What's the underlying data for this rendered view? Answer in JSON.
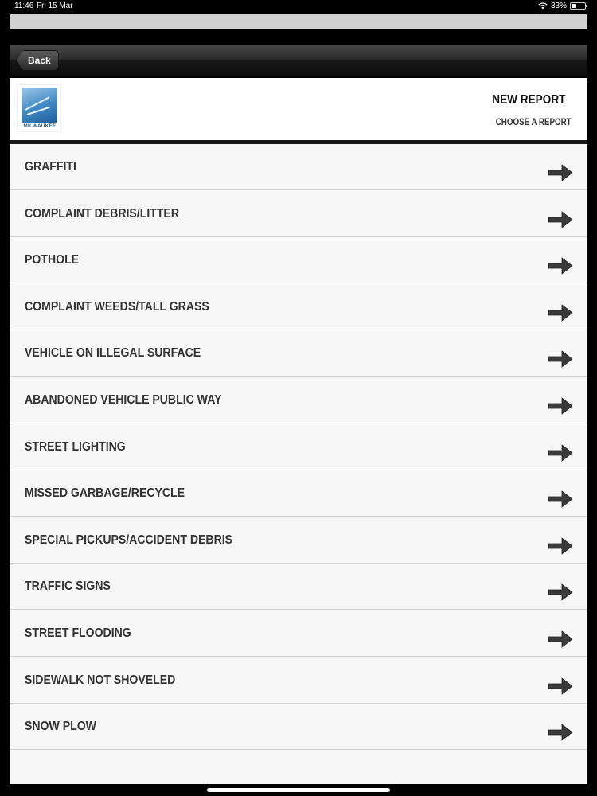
{
  "status": {
    "time": "11:46",
    "date": "Fri 15 Mar",
    "battery": "33%",
    "battery_level": 0.33
  },
  "nav": {
    "back_label": "Back"
  },
  "header": {
    "logo_text": "MILWAUKEE",
    "title": "NEW REPORT",
    "subtitle": "CHOOSE A REPORT"
  },
  "reports": [
    "GRAFFITI",
    "COMPLAINT DEBRIS/LITTER",
    "POTHOLE",
    "COMPLAINT WEEDS/TALL GRASS",
    "VEHICLE ON ILLEGAL SURFACE",
    "ABANDONED VEHICLE PUBLIC WAY",
    "STREET LIGHTING",
    "MISSED GARBAGE/RECYCLE",
    "SPECIAL PICKUPS/ACCIDENT DEBRIS",
    "TRAFFIC SIGNS",
    "STREET FLOODING",
    "SIDEWALK NOT SHOVELED",
    "SNOW PLOW"
  ],
  "icons": {
    "row_action": "right-arrow-icon"
  },
  "colors": {
    "nav_bar": "#1f1f1f",
    "list_background": "#f7f7f8",
    "label_text": "#333333",
    "arrow": "#3a3a3a"
  }
}
